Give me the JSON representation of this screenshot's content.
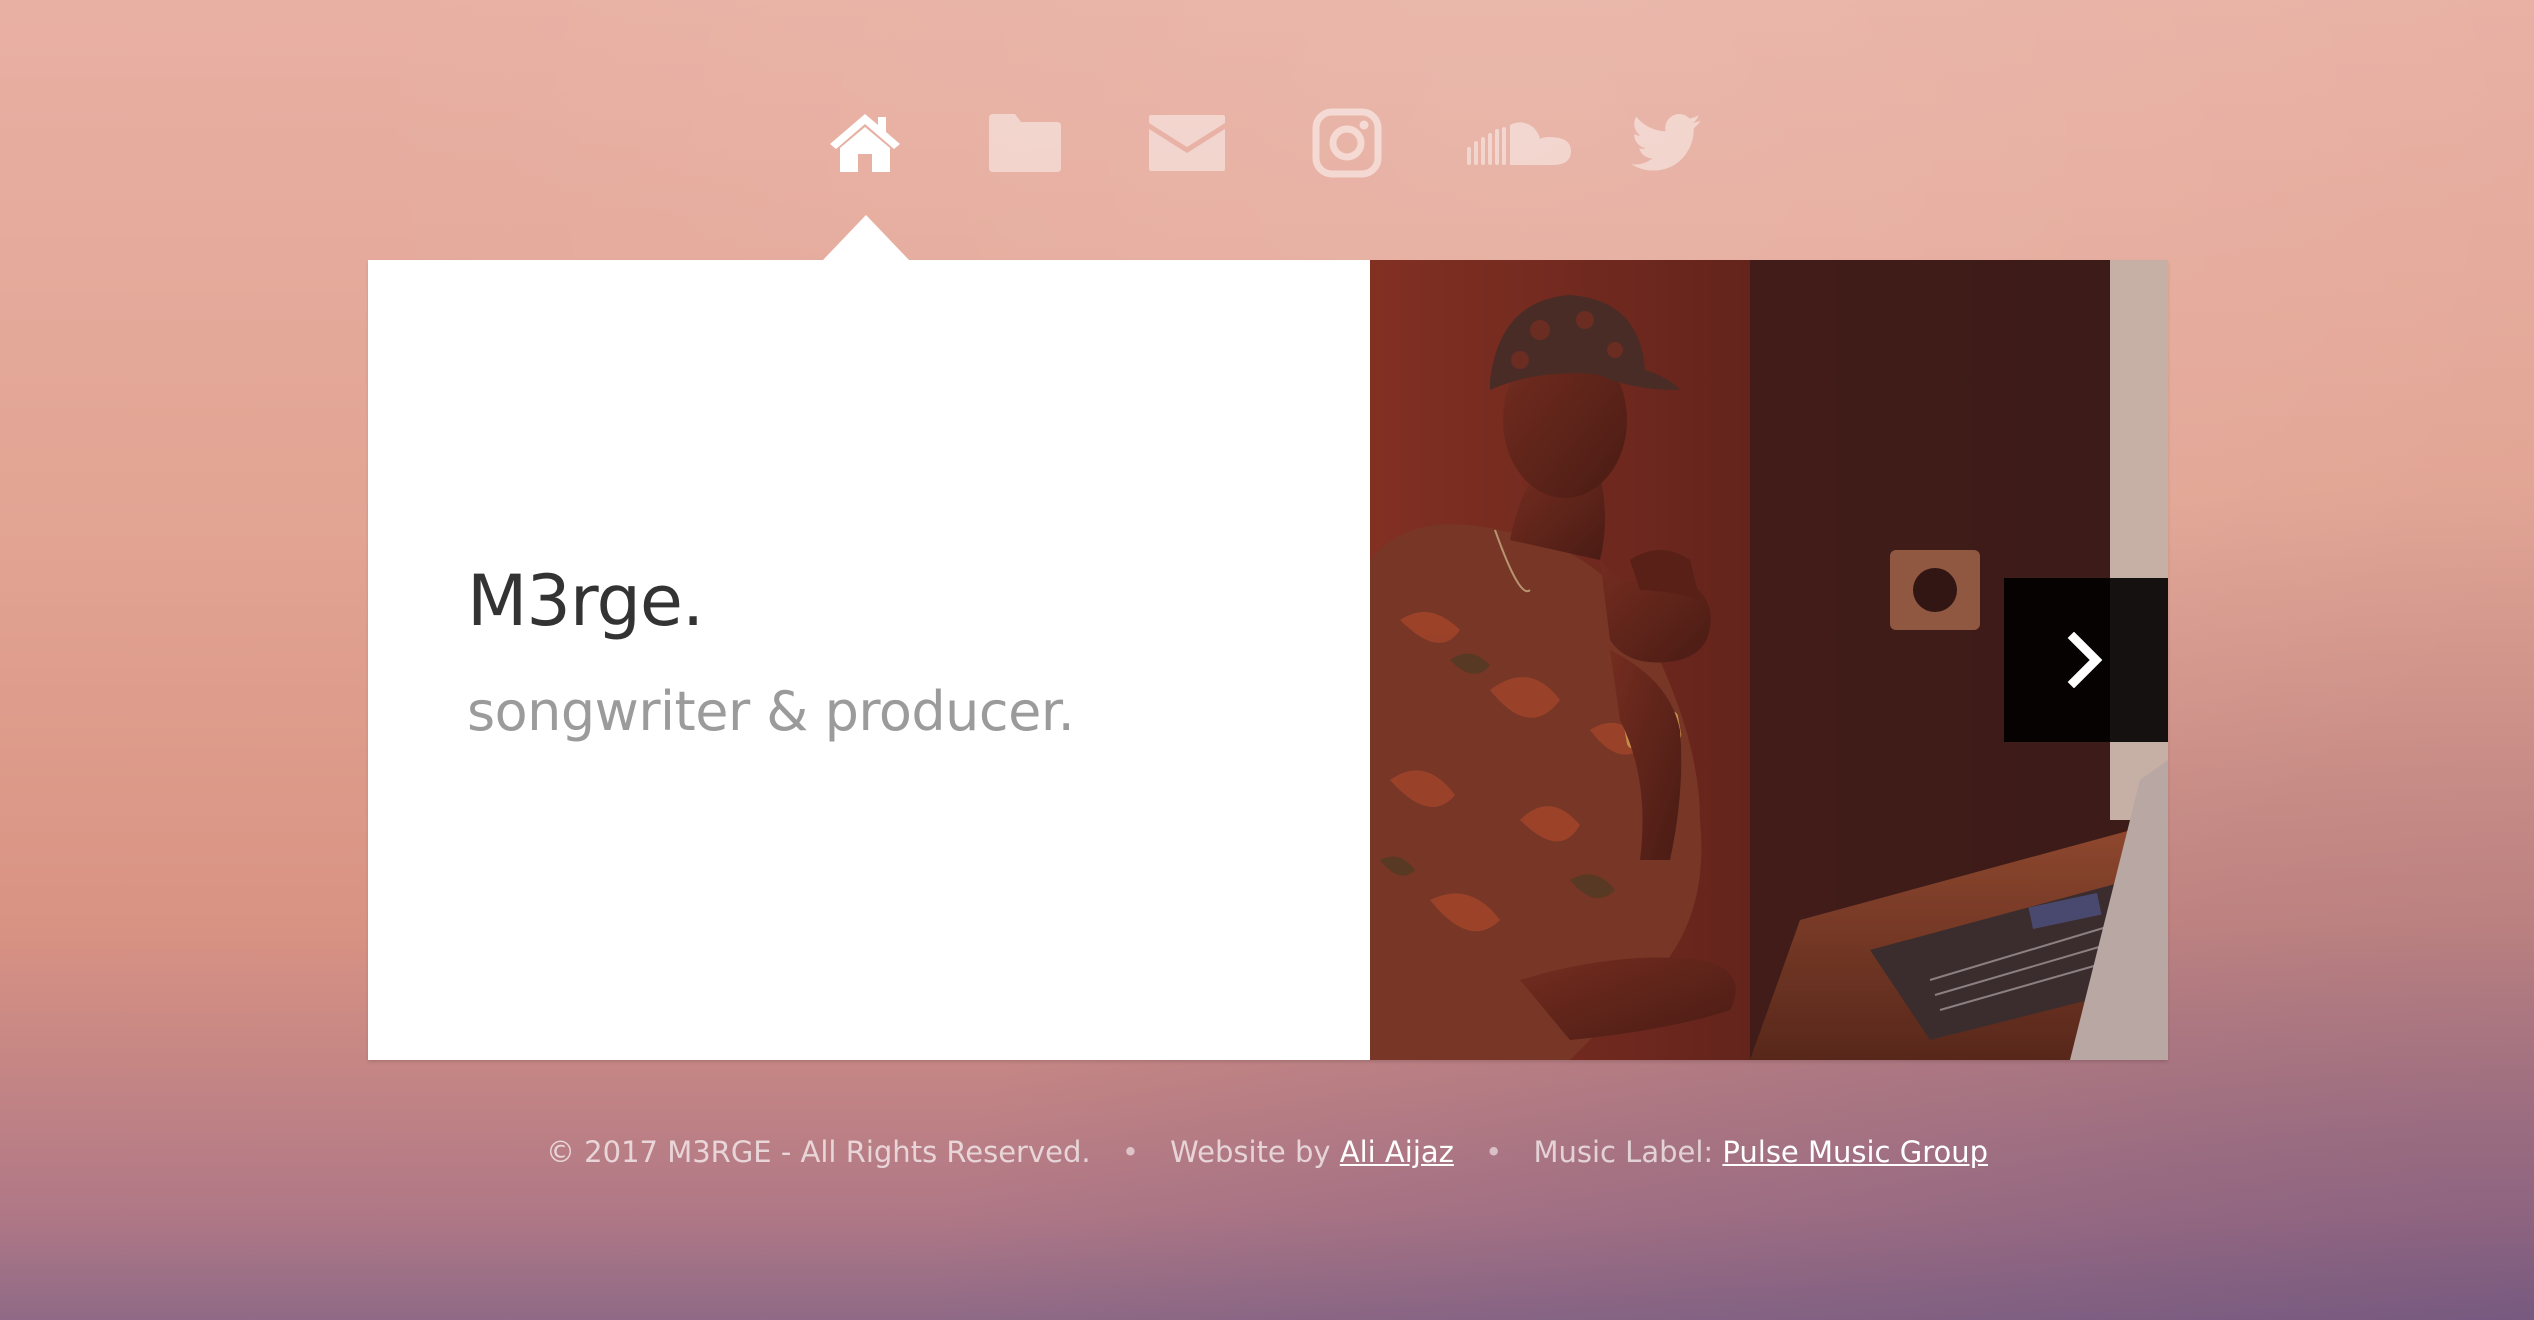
{
  "site": {
    "title": "M3rge.",
    "subtitle": "songwriter & producer."
  },
  "nav": {
    "items": [
      {
        "icon": "home-icon",
        "active": true
      },
      {
        "icon": "folder-icon",
        "active": false
      },
      {
        "icon": "mail-icon",
        "active": false
      },
      {
        "icon": "instagram-icon",
        "active": false
      },
      {
        "icon": "soundcloud-icon",
        "active": false
      },
      {
        "icon": "twitter-icon",
        "active": false
      }
    ]
  },
  "slider": {
    "next_icon": "chevron-right-icon"
  },
  "footer": {
    "copyright": "© 2017 M3RGE - All Rights Reserved.",
    "separator": "•",
    "website_prefix": "Website by",
    "website_link": "Ali Aijaz",
    "label_prefix": "Music Label:",
    "label_link": "Pulse Music Group"
  },
  "colors": {
    "background_top": "#e8b0a3",
    "background_bottom": "#8f6a86",
    "card": "#ffffff",
    "title": "#333333",
    "subtitle": "#9b9b9b",
    "next_button": "#000000"
  }
}
